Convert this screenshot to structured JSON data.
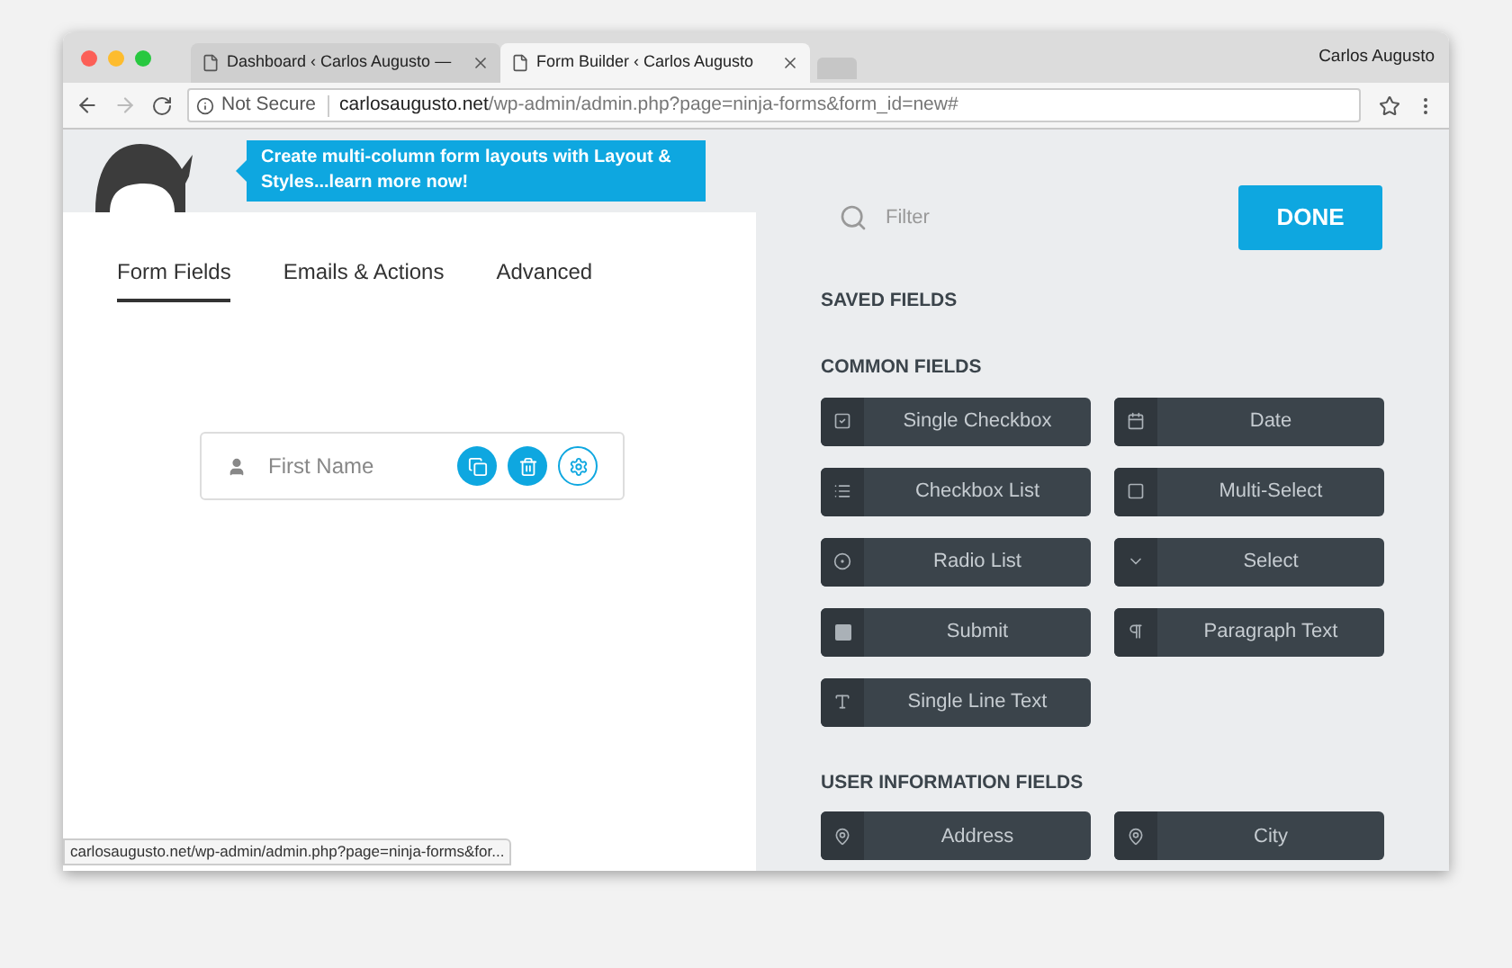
{
  "browser": {
    "tabs": [
      {
        "title": "Dashboard ‹ Carlos Augusto —",
        "selected": false
      },
      {
        "title": "Form Builder ‹ Carlos Augusto",
        "selected": true
      }
    ],
    "profile": "Carlos Augusto",
    "security": "Not Secure",
    "url_host": "carlosaugusto.net",
    "url_path": "/wp-admin/admin.php?page=ninja-forms&form_id=new#"
  },
  "callout": "Create multi-column form layouts with Layout & Styles...learn more now!",
  "builder_tabs": [
    {
      "label": "Form Fields",
      "selected": true
    },
    {
      "label": "Emails & Actions",
      "selected": false
    },
    {
      "label": "Advanced",
      "selected": false
    }
  ],
  "form_field": {
    "label": "First Name"
  },
  "filter": {
    "placeholder": "Filter"
  },
  "done_button": "DONE",
  "sections": [
    {
      "title": "SAVED FIELDS"
    },
    {
      "title": "COMMON FIELDS",
      "fields": [
        "Single Checkbox",
        "Date",
        "Checkbox List",
        "Multi-Select",
        "Radio List",
        "Select",
        "Submit",
        "Paragraph Text",
        "Single Line Text"
      ]
    },
    {
      "title": "USER INFORMATION FIELDS",
      "fields": [
        "Address",
        "City"
      ]
    }
  ],
  "status_url": "carlosaugusto.net/wp-admin/admin.php?page=ninja-forms&for..."
}
